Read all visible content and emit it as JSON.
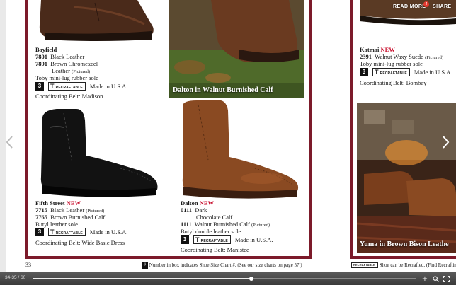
{
  "header": {
    "read_more_label": "READ MORE",
    "share_label": "SHARE",
    "notification_count": "4"
  },
  "products": {
    "bayfield": {
      "name": "Bayfield",
      "line1_num": "7801",
      "line1_desc": "Black Leather",
      "line2_num": "7891",
      "line2_desc": "Brown Chromexcel",
      "line2_desc_b": "Leather",
      "line2_pictured": "(Pictured)",
      "sole": "Toby mini-lug rubber sole",
      "size_chart": "3",
      "recraftable": "RECRAFTABLE",
      "made_in": "Made in U.S.A.",
      "belt": "Coordinating Belt: Madison"
    },
    "fifth_street": {
      "name": "Fifth Street",
      "new_tag": "NEW",
      "line1_num": "7715",
      "line1_desc": "Black Leather",
      "line1_pictured": "(Pictured)",
      "line2_num": "7765",
      "line2_desc": "Brown Burnished Calf",
      "sole": "Butyl leather sole",
      "size_chart": "3",
      "recraftable": "RECRAFTABLE",
      "made_in": "Made in U.S.A.",
      "belt": "Coordinating Belt: Wide Basic Dress"
    },
    "dalton": {
      "name": "Dalton",
      "new_tag": "NEW",
      "line1_num": "0111",
      "line1_desc": "Dark",
      "line1_desc_b": "Chocolate Calf",
      "line2_num": "1111",
      "line2_desc": "Walnut Burnished Calf",
      "line2_pictured": "(Pictured)",
      "sole": "Butyl double leather sole",
      "size_chart": "3",
      "recraftable": "RECRAFTABLE",
      "made_in": "Made in U.S.A.",
      "belt": "Coordinating Belt: Manistee"
    },
    "katmai": {
      "name": "Katmai",
      "new_tag": "NEW",
      "line1_num": "2391",
      "line1_desc": "Walnut Waxy Suede",
      "line1_pictured": "(Pictured)",
      "sole": "Toby mini-lug rubber sole",
      "size_chart": "3",
      "recraftable": "RECRAFTABLE",
      "made_in": "Made in U.S.A.",
      "belt": "Coordinating Belt: Bombay"
    }
  },
  "captions": {
    "dalton_lifestyle": "Dalton in Walnut Burnished Calf",
    "yuma_lifestyle": "Yuma in Brown Bison Leathe"
  },
  "footer": {
    "page_number": "33",
    "size_note_box": "#",
    "size_note": "Number in box indicates Shoe Size Chart #. (See our size charts on page 57.)",
    "recraft_note_badge": "RECRAFTABLE",
    "recraft_note": "Shoe can be Recrafted. (Find Recraftin"
  },
  "toolbar": {
    "page_indicator": "34-35 / 60",
    "progress": 0.57
  },
  "icons": {
    "prev": "chevron-left-icon",
    "next": "chevron-right-icon",
    "zoom_in": "zoom-in-icon",
    "search": "search-icon",
    "fullscreen": "fullscreen-icon"
  },
  "colors": {
    "frame": "#7c1a2a",
    "new_tag": "#c8102e",
    "notification": "#e4392f"
  }
}
